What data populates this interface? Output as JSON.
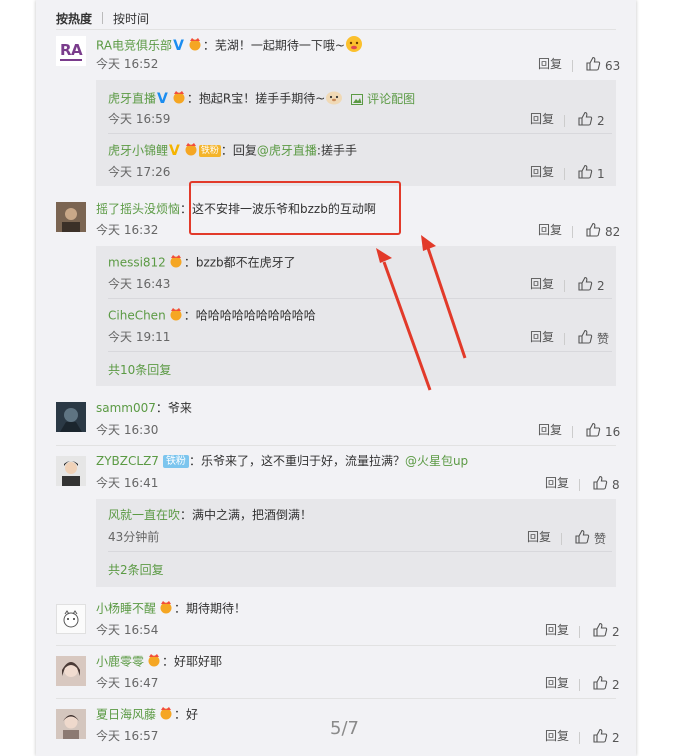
{
  "sort": {
    "hot": "按热度",
    "time": "按时间"
  },
  "reply_label": "回复",
  "page_indicator": "5/7",
  "comments": [
    {
      "user": "RA电竞俱乐部",
      "text": "：芜湖！一起期待一下哦~",
      "time": "今天 16:52",
      "likes": "63",
      "replies": [
        {
          "user": "虎牙直播",
          "text": "：抱起R宝！搓手手期待~",
          "note": "评论配图",
          "time": "今天 16:59",
          "likes": "2"
        },
        {
          "user": "虎牙小锦鲤",
          "tag": "铁粉",
          "text_prefix": "：回复",
          "mention": "@虎牙直播",
          "text": ":搓手手",
          "time": "今天 17:26",
          "likes": "1"
        }
      ]
    },
    {
      "user": "摇了摇头没烦恼",
      "text": "：这不安排一波乐爷和bzzb的互动啊",
      "time": "今天 16:32",
      "likes": "82",
      "replies": [
        {
          "user": "messi812",
          "text": "：bzzb都不在虎牙了",
          "time": "今天 16:43",
          "likes": "2"
        },
        {
          "user": "CiheChen",
          "text": "：哈哈哈哈哈哈哈哈哈哈",
          "time": "今天 19:11",
          "likes": "赞"
        }
      ],
      "more": "共10条回复"
    },
    {
      "user": "samm007",
      "text": "：爷来",
      "time": "今天 16:30",
      "likes": "16"
    },
    {
      "user": "ZYBZCLZ7",
      "tag": "铁粉",
      "text": "：乐爷来了，这不重归于好，流量拉满？",
      "mention": "@火星包up",
      "time": "今天 16:41",
      "likes": "8",
      "replies": [
        {
          "user": "风就一直在吹",
          "text": "：满中之满，把酒倒满！",
          "time": "43分钟前",
          "likes": "赞"
        }
      ],
      "more": "共2条回复"
    },
    {
      "user": "小杨睡不醒",
      "text": "：期待期待！",
      "time": "今天 16:54",
      "likes": "2"
    },
    {
      "user": "小鹿零零",
      "text": "：好耶好耶",
      "time": "今天 16:47",
      "likes": "2"
    },
    {
      "user": "夏日海风藤",
      "text": "：好",
      "time": "今天 16:57",
      "likes": "2"
    }
  ],
  "colors": {
    "username": "#5b9a44",
    "annotation": "#e23a2a",
    "page_bg": "#f2f2f5"
  },
  "icons": [
    "like-icon",
    "vip-crown-icon",
    "verified-v-icon",
    "image-icon"
  ]
}
